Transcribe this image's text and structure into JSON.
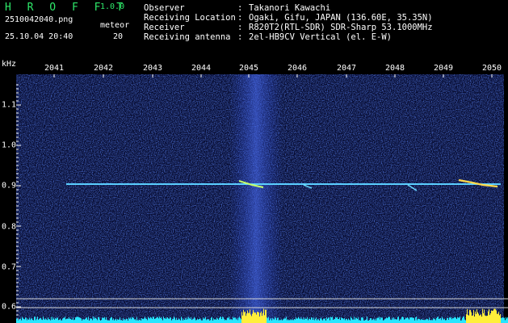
{
  "app": {
    "name": "H R O F F T",
    "version": "1.0.0"
  },
  "file": {
    "name": "2510042040.png",
    "timestamp": "25.10.04 20:40"
  },
  "meteor": {
    "label": "meteor",
    "count": "20"
  },
  "info": [
    {
      "key": "Observer",
      "value": "Takanori Kawachi"
    },
    {
      "key": "Receiving Location",
      "value": "Ogaki, Gifu, JAPAN (136.60E, 35.35N)"
    },
    {
      "key": "Receiver",
      "value": "R820T2(RTL-SDR) SDR-Sharp 53.1000MHz"
    },
    {
      "key": "Receiving antenna",
      "value": "2el-HB9CV Vertical (el. E-W)"
    }
  ],
  "axes": {
    "y_unit": "kHz",
    "x_ticks": [
      "2041",
      "2042",
      "2043",
      "2044",
      "2045",
      "2046",
      "2047",
      "2048",
      "2049",
      "2050"
    ],
    "y_ticks": [
      "1.1",
      "1.0",
      "0.9",
      "0.8",
      "0.7",
      "0.6"
    ]
  },
  "colors": {
    "background": "#000000",
    "brand": "#2ee86a",
    "noise": "#1b2ea8",
    "signal": "#5ee6ff",
    "meteor_head": "#ffef3a",
    "level": "#27e6ff"
  }
}
